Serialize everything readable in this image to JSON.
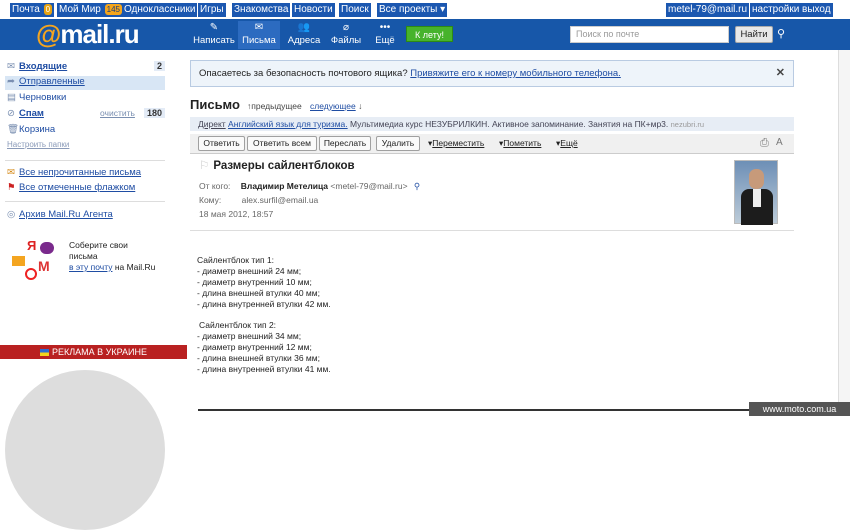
{
  "topbar": {
    "items": [
      {
        "label": "Почта",
        "badge": "0"
      },
      {
        "label": "Мой Мир",
        "badge": "145"
      },
      {
        "label": "Одноклассники"
      },
      {
        "label": "Игры"
      },
      {
        "label": "Знакомства"
      },
      {
        "label": "Новости"
      },
      {
        "label": "Поиск"
      },
      {
        "label": "Все проекты"
      }
    ],
    "user": "metel-79@mail.ru",
    "settings": "настройки",
    "logout": "выход"
  },
  "header": {
    "logo": "mail.ru",
    "nav": [
      {
        "label": "Написать",
        "icon": "pencil-icon"
      },
      {
        "label": "Письма",
        "icon": "envelope-icon"
      },
      {
        "label": "Адреса",
        "icon": "contacts-icon"
      },
      {
        "label": "Файлы",
        "icon": "paperclip-icon"
      },
      {
        "label": "Ещё",
        "icon": "more-icon"
      }
    ],
    "summer_button": "К лету!",
    "search_placeholder": "Поиск по почте",
    "find_button": "Найти"
  },
  "sidebar": {
    "folders": [
      {
        "label": "Входящие",
        "count": "2"
      },
      {
        "label": "Отправленные"
      },
      {
        "label": "Черновики"
      },
      {
        "label": "Спам",
        "action": "очистить",
        "count": "180"
      },
      {
        "label": "Корзина"
      }
    ],
    "setup_folders": "Настроить папки",
    "all_unread": "Все непрочитанные письма",
    "all_flagged": "Все отмеченные флажком",
    "agent_archive": "Архив Mail.Ru Агента",
    "collect_text_1": "Соберите свои",
    "collect_text_2": "письма",
    "collect_link": "в эту почту",
    "collect_suffix": " на Mail.Ru",
    "promo": "РЕКЛАМА В УКРАИНЕ"
  },
  "alert": {
    "text": "Опасаетесь за безопасность почтового ящика? ",
    "link": "Привяжите его к номеру мобильного телефона."
  },
  "letter": {
    "page_title": "Письмо",
    "prev": "предыдущее",
    "next": "следующее",
    "ad_prefix": "Директ",
    "ad_link": "Английский язык для туризма.",
    "ad_text": " Мультимедиа курс НЕЗУБРИЛКИН. Активное запоминание. Занятия на ПК+мр3.",
    "ad_domain": "nezubri.ru",
    "toolbar": {
      "reply": "Ответить",
      "reply_all": "Ответить всем",
      "forward": "Переслать",
      "delete": "Удалить",
      "move": "Переместить",
      "mark": "Пометить",
      "more": "Ещё"
    },
    "subject": "Размеры сайлентблоков",
    "from_label": "От кого:",
    "from_name": "Владимир Метелица",
    "from_email": "<metel-79@mail.ru>",
    "to_label": "Кому:",
    "to_email": "alex.surfil@email.ua",
    "date": "18 мая 2012, 18:57",
    "body_block1": [
      "Сайлентблок тип 1:",
      "- диаметр внешний 24 мм;",
      "- диаметр внутренний 10 мм;",
      "- длина внешней втулки 40 мм;",
      "- длина внутренней втулки 42 мм."
    ],
    "body_block2": [
      "Сайлентблок тип 2:",
      "- диаметр внешний 34 мм;",
      "- диаметр внутренний 12 мм;",
      "- длина внешней втулки 36 мм;",
      "- длина внутренней втулки 41 мм."
    ]
  },
  "watermark": "www.moto.com.ua"
}
